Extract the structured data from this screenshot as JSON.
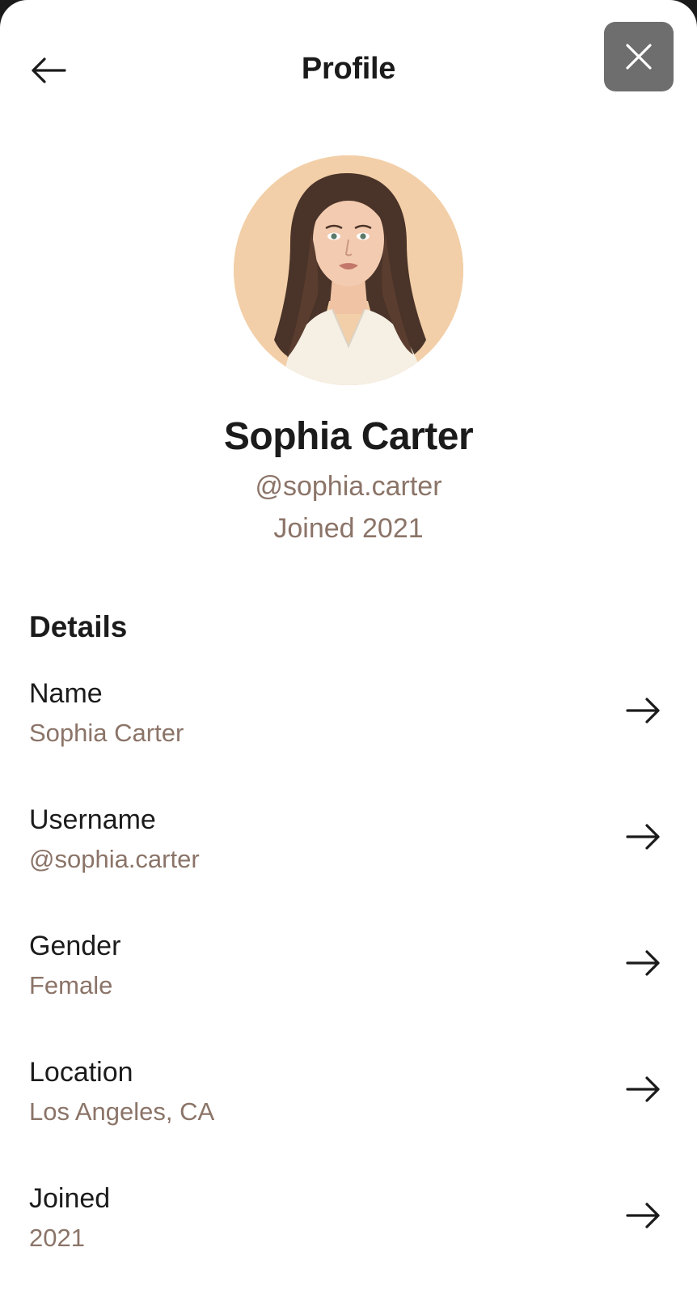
{
  "header": {
    "title": "Profile",
    "back_icon": "arrow-left-icon",
    "close_icon": "close-icon"
  },
  "profile": {
    "name": "Sophia Carter",
    "handle": "@sophia.carter",
    "joined": "Joined 2021",
    "avatar": "illustrated-woman-portrait"
  },
  "details": {
    "title": "Details",
    "items": [
      {
        "label": "Name",
        "value": "Sophia Carter"
      },
      {
        "label": "Username",
        "value": "@sophia.carter"
      },
      {
        "label": "Gender",
        "value": "Female"
      },
      {
        "label": "Location",
        "value": "Los Angeles, CA"
      },
      {
        "label": "Joined",
        "value": "2021"
      }
    ]
  },
  "colors": {
    "text_primary": "#1b1b1b",
    "text_secondary": "#8b7468",
    "close_button_bg": "#6e6e6e",
    "avatar_bg": "#f2cfa8"
  }
}
